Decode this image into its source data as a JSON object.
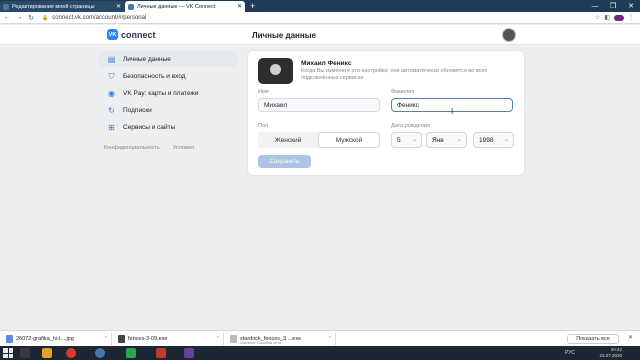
{
  "browser": {
    "tabs": [
      {
        "title": "Редактирование моей страницы",
        "active": false
      },
      {
        "title": "Личные данные — VK Connect",
        "active": true
      }
    ],
    "url": "connect.vk.com/account/#/personal"
  },
  "header": {
    "logo_text": "connect",
    "logo_badge": "VK",
    "page_title": "Личные данные"
  },
  "sidebar": {
    "items": [
      {
        "label": "Личные данные",
        "icon": "user-icon",
        "active": true
      },
      {
        "label": "Безопасность и вход",
        "icon": "shield-icon",
        "active": false
      },
      {
        "label": "VK Pay: карты и платежи",
        "icon": "vkpay-icon",
        "active": false
      },
      {
        "label": "Подписки",
        "icon": "subscriptions-icon",
        "active": false
      },
      {
        "label": "Сервисы и сайты",
        "icon": "grid-icon",
        "active": false
      }
    ],
    "footer_links": [
      "Конфиденциальность",
      "Условия"
    ]
  },
  "profile": {
    "name": "Михаил Феникс",
    "hint": "Когда Вы измените эти настройки, они автоматически обновятся во всех подключённых сервисах"
  },
  "form": {
    "first_name_label": "Имя",
    "first_name_value": "Михаил",
    "last_name_label": "Фамилия",
    "last_name_value": "Феникс",
    "gender_label": "Пол",
    "gender_options": [
      "Женский",
      "Мужской"
    ],
    "gender_selected": "Мужской",
    "birthdate_label": "Дата рождения",
    "birth_day": "5",
    "birth_month": "Янв",
    "birth_year": "1998",
    "save_label": "Сохранить"
  },
  "downloads": {
    "items": [
      {
        "name": "26072-grafika_hi-t....jpg",
        "sub": ""
      },
      {
        "name": "fences-3-09.exe",
        "sub": ""
      },
      {
        "name": "stardock_fences_3....exe",
        "sub": "Ошибка: Ошибка сети"
      }
    ],
    "show_all_label": "Показать все"
  },
  "taskbar": {
    "language": "РУС",
    "time": "20:42",
    "date": "23.07.2020"
  },
  "colors": {
    "accent": "#2787f5",
    "save_button": "#a9c4e6",
    "focus_border": "#5181b8"
  }
}
